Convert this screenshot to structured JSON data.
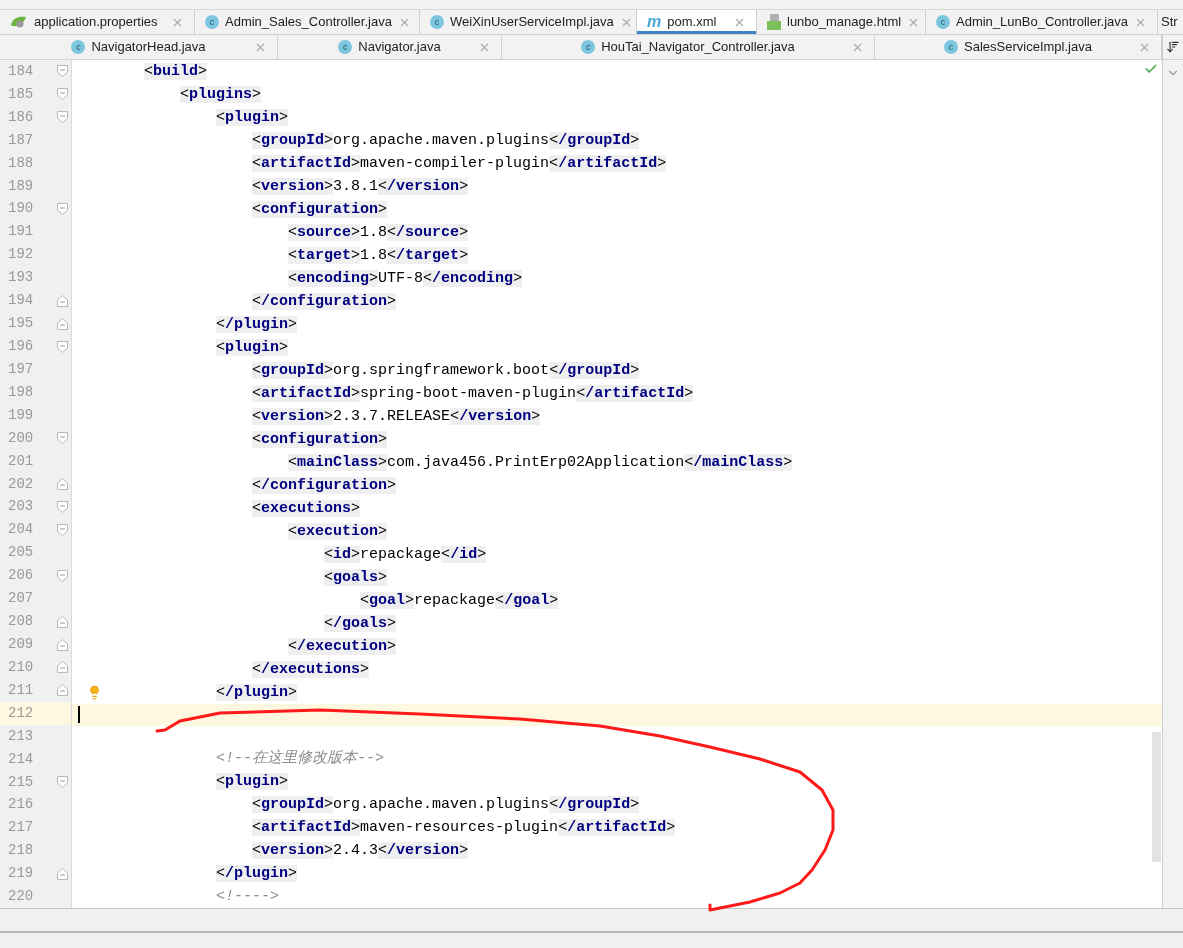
{
  "tabs_row_1": [
    {
      "label": "application.properties",
      "kind": "spring",
      "selected": false
    },
    {
      "label": "Admin_Sales_Controller.java",
      "kind": "class",
      "icon": "c",
      "selected": false
    },
    {
      "label": "WeiXinUserServiceImpl.java",
      "kind": "class",
      "icon": "c",
      "selected": false
    },
    {
      "label": "pom.xml",
      "kind": "maven",
      "icon": "m",
      "selected": true
    },
    {
      "label": "lunbo_manage.html",
      "kind": "html",
      "selected": false
    },
    {
      "label": "Admin_LunBo_Controller.java",
      "kind": "class",
      "icon": "c",
      "selected": false
    },
    {
      "label": "Str",
      "kind": "cut",
      "selected": false
    }
  ],
  "tabs_row_2": [
    {
      "label": "NavigatorHead.java",
      "kind": "class",
      "icon": "c",
      "selected": false
    },
    {
      "label": "Navigator.java",
      "kind": "class",
      "icon": "c",
      "selected": false
    },
    {
      "label": "HouTai_Navigator_Controller.java",
      "kind": "class",
      "icon": "c",
      "selected": false
    },
    {
      "label": "SalesServiceImpl.java",
      "kind": "class",
      "icon": "c",
      "selected": false
    }
  ],
  "editor": {
    "lines": [
      {
        "number": "184",
        "kind": "code",
        "text": "    <build>",
        "fold_start": true
      },
      {
        "number": "185",
        "kind": "code",
        "text": "        <plugins>",
        "fold_start": true
      },
      {
        "number": "186",
        "kind": "code",
        "text": "            <plugin>",
        "fold_start": true
      },
      {
        "number": "187",
        "kind": "code",
        "text": "                <groupId>org.apache.maven.plugins</groupId>"
      },
      {
        "number": "188",
        "kind": "code",
        "text": "                <artifactId>maven-compiler-plugin</artifactId>"
      },
      {
        "number": "189",
        "kind": "code",
        "text": "                <version>3.8.1</version>"
      },
      {
        "number": "190",
        "kind": "code",
        "text": "                <configuration>",
        "fold_start": true
      },
      {
        "number": "191",
        "kind": "code",
        "text": "                    <source>1.8</source>"
      },
      {
        "number": "192",
        "kind": "code",
        "text": "                    <target>1.8</target>"
      },
      {
        "number": "193",
        "kind": "code",
        "text": "                    <encoding>UTF-8</encoding>"
      },
      {
        "number": "194",
        "kind": "code",
        "text": "                </configuration>",
        "fold_end": true
      },
      {
        "number": "195",
        "kind": "code",
        "text": "            </plugin>",
        "fold_end": true
      },
      {
        "number": "196",
        "kind": "code",
        "text": "            <plugin>",
        "fold_start": true
      },
      {
        "number": "197",
        "kind": "code",
        "text": "                <groupId>org.springframework.boot</groupId>"
      },
      {
        "number": "198",
        "kind": "code",
        "text": "                <artifactId>spring-boot-maven-plugin</artifactId>"
      },
      {
        "number": "199",
        "kind": "code",
        "text": "                <version>2.3.7.RELEASE</version>"
      },
      {
        "number": "200",
        "kind": "code",
        "text": "                <configuration>",
        "fold_start": true
      },
      {
        "number": "201",
        "kind": "code",
        "text": "                    <mainClass>com.java456.PrintErp02Application</mainClass>"
      },
      {
        "number": "202",
        "kind": "code",
        "text": "                </configuration>",
        "fold_end": true
      },
      {
        "number": "203",
        "kind": "code",
        "text": "                <executions>",
        "fold_start": true
      },
      {
        "number": "204",
        "kind": "code",
        "text": "                    <execution>",
        "fold_start": true
      },
      {
        "number": "205",
        "kind": "code",
        "text": "                        <id>repackage</id>"
      },
      {
        "number": "206",
        "kind": "code",
        "text": "                        <goals>",
        "fold_start": true
      },
      {
        "number": "207",
        "kind": "code",
        "text": "                            <goal>repackage</goal>"
      },
      {
        "number": "208",
        "kind": "code",
        "text": "                        </goals>",
        "fold_end": true
      },
      {
        "number": "209",
        "kind": "code",
        "text": "                    </execution>",
        "fold_end": true
      },
      {
        "number": "210",
        "kind": "code",
        "text": "                </executions>",
        "fold_end": true
      },
      {
        "number": "211",
        "kind": "code",
        "text": "            </plugin>",
        "fold_end": true,
        "bulb": true
      },
      {
        "number": "212",
        "kind": "blank",
        "current": true
      },
      {
        "number": "213",
        "kind": "blank"
      },
      {
        "number": "214",
        "kind": "comment",
        "text": "            <!--在这里修改版本-->"
      },
      {
        "number": "215",
        "kind": "code",
        "text": "            <plugin>",
        "fold_start": true
      },
      {
        "number": "216",
        "kind": "code",
        "text": "                <groupId>org.apache.maven.plugins</groupId>"
      },
      {
        "number": "217",
        "kind": "code",
        "text": "                <artifactId>maven-resources-plugin</artifactId>"
      },
      {
        "number": "218",
        "kind": "code",
        "text": "                <version>2.4.3</version>"
      },
      {
        "number": "219",
        "kind": "code",
        "text": "            </plugin>",
        "fold_end": true
      },
      {
        "number": "220",
        "kind": "comment",
        "text": "            <!---->"
      }
    ]
  }
}
